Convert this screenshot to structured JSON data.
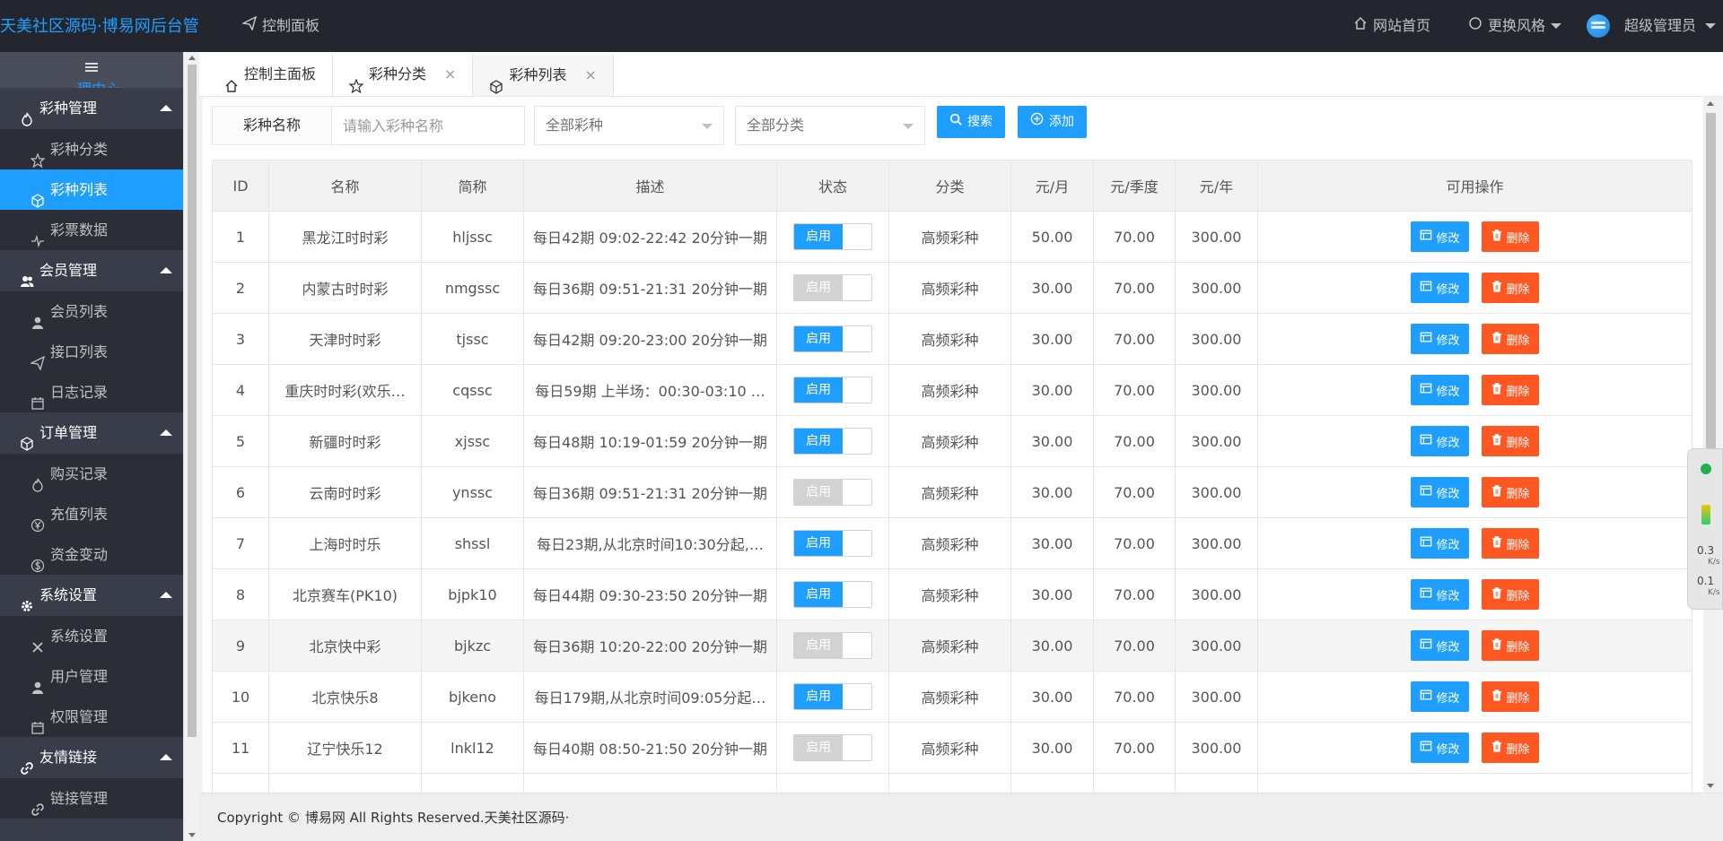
{
  "header": {
    "logo": "天美社区源码·博易网后台管",
    "dashboard_link": "控制面板",
    "site_home": "网站首页",
    "change_style": "更换风格",
    "user": "超级管理员"
  },
  "sidebar": {
    "toggle_sub": "理中心",
    "groups": [
      {
        "label": "彩种管理",
        "items": [
          "彩种分类",
          "彩种列表",
          "彩票数据"
        ]
      },
      {
        "label": "会员管理",
        "items": [
          "会员列表",
          "接口列表",
          "日志记录"
        ]
      },
      {
        "label": "订单管理",
        "items": [
          "购买记录",
          "充值列表",
          "资金变动"
        ]
      },
      {
        "label": "系统设置",
        "items": [
          "系统设置",
          "用户管理",
          "权限管理"
        ]
      },
      {
        "label": "友情链接",
        "items": [
          "链接管理"
        ]
      }
    ]
  },
  "tabs": [
    "控制主面板",
    "彩种分类",
    "彩种列表"
  ],
  "search": {
    "label": "彩种名称",
    "placeholder": "请输入彩种名称",
    "select1": "全部彩种",
    "select2": "全部分类",
    "search_btn": "搜索",
    "add_btn": "添加"
  },
  "table": {
    "headers": [
      "ID",
      "名称",
      "简称",
      "描述",
      "状态",
      "分类",
      "元/月",
      "元/季度",
      "元/年",
      "可用操作"
    ],
    "switch_label": "启用",
    "edit_label": "修改",
    "delete_label": "删除",
    "rows": [
      {
        "id": "1",
        "name": "黑龙江时时彩",
        "abbr": "hljssc",
        "desc": "每日42期 09:02-22:42 20分钟一期",
        "enabled": true,
        "category": "高频彩种",
        "month": "50.00",
        "quarter": "70.00",
        "year": "300.00"
      },
      {
        "id": "2",
        "name": "内蒙古时时彩",
        "abbr": "nmgssc",
        "desc": "每日36期 09:51-21:31 20分钟一期",
        "enabled": false,
        "category": "高频彩种",
        "month": "30.00",
        "quarter": "70.00",
        "year": "300.00"
      },
      {
        "id": "3",
        "name": "天津时时彩",
        "abbr": "tjssc",
        "desc": "每日42期 09:20-23:00 20分钟一期",
        "enabled": true,
        "category": "高频彩种",
        "month": "30.00",
        "quarter": "70.00",
        "year": "300.00"
      },
      {
        "id": "4",
        "name": "重庆时时彩(欢乐…",
        "abbr": "cqssc",
        "desc": "每日59期 上半场：00:30-03:10 …",
        "enabled": true,
        "category": "高频彩种",
        "month": "30.00",
        "quarter": "70.00",
        "year": "300.00"
      },
      {
        "id": "5",
        "name": "新疆时时彩",
        "abbr": "xjssc",
        "desc": "每日48期 10:19-01:59 20分钟一期",
        "enabled": true,
        "category": "高频彩种",
        "month": "30.00",
        "quarter": "70.00",
        "year": "300.00"
      },
      {
        "id": "6",
        "name": "云南时时彩",
        "abbr": "ynssc",
        "desc": "每日36期 09:51-21:31 20分钟一期",
        "enabled": false,
        "category": "高频彩种",
        "month": "30.00",
        "quarter": "70.00",
        "year": "300.00"
      },
      {
        "id": "7",
        "name": "上海时时乐",
        "abbr": "shssl",
        "desc": "每日23期,从北京时间10:30分起,…",
        "enabled": true,
        "category": "高频彩种",
        "month": "30.00",
        "quarter": "70.00",
        "year": "300.00"
      },
      {
        "id": "8",
        "name": "北京赛车(PK10)",
        "abbr": "bjpk10",
        "desc": "每日44期 09:30-23:50 20分钟一期",
        "enabled": true,
        "category": "高频彩种",
        "month": "30.00",
        "quarter": "70.00",
        "year": "300.00"
      },
      {
        "id": "9",
        "name": "北京快中彩",
        "abbr": "bjkzc",
        "desc": "每日36期 10:20-22:00 20分钟一期",
        "enabled": false,
        "category": "高频彩种",
        "month": "30.00",
        "quarter": "70.00",
        "year": "300.00"
      },
      {
        "id": "10",
        "name": "北京快乐8",
        "abbr": "bjkeno",
        "desc": "每日179期,从北京时间09:05分起…",
        "enabled": true,
        "category": "高频彩种",
        "month": "30.00",
        "quarter": "70.00",
        "year": "300.00"
      },
      {
        "id": "11",
        "name": "辽宁快乐12",
        "abbr": "lnkl12",
        "desc": "每日40期 08:50-21:50 20分钟一期",
        "enabled": false,
        "category": "高频彩种",
        "month": "30.00",
        "quarter": "70.00",
        "year": "300.00"
      }
    ]
  },
  "speed_widget": {
    "up": "0.3",
    "down": "0.1",
    "unit": "K/s"
  },
  "footer": "Copyright © 博易网 All Rights Reserved.天美社区源码·"
}
